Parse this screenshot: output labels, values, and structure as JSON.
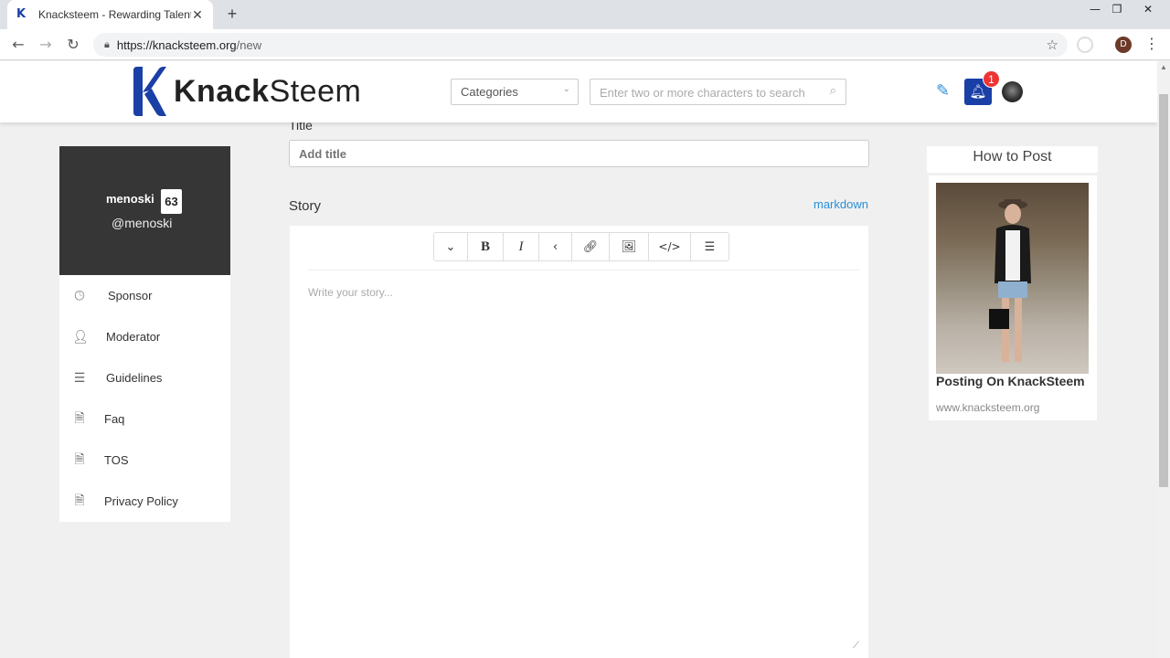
{
  "browser": {
    "tab_title": "Knacksteem - Rewarding Talent",
    "tab_close": "✕",
    "new_tab": "+",
    "url_host": "https://knacksteem.org",
    "url_path": "/new",
    "profile_initial": "D"
  },
  "header": {
    "logo_knack": "Knack",
    "logo_steem": "Steem",
    "categories_label": "Categories",
    "search_placeholder": "Enter two or more characters to search",
    "notification_count": "1"
  },
  "profile": {
    "name": "menoski",
    "reputation": "63",
    "handle": "@menoski"
  },
  "sidebar": {
    "items": [
      {
        "label": "Sponsor",
        "icon": "clock-icon"
      },
      {
        "label": "Moderator",
        "icon": "user-icon"
      },
      {
        "label": "Guidelines",
        "icon": "lines-icon"
      },
      {
        "label": "Faq",
        "icon": "document-icon"
      },
      {
        "label": "TOS",
        "icon": "document-icon"
      },
      {
        "label": "Privacy Policy",
        "icon": "document-icon"
      }
    ]
  },
  "editor": {
    "title_label": "Title",
    "title_placeholder": "Add title",
    "story_label": "Story",
    "markdown_link": "markdown",
    "story_placeholder": "Write your story..."
  },
  "howto": {
    "heading": "How to Post",
    "card_title": "Posting On KnackSteem",
    "card_url": "www.knacksteem.org"
  },
  "colors": {
    "brand_blue": "#1a3fa6",
    "link_blue": "#2a8fd6",
    "profile_bg": "#363636",
    "badge_red": "#e33333"
  }
}
